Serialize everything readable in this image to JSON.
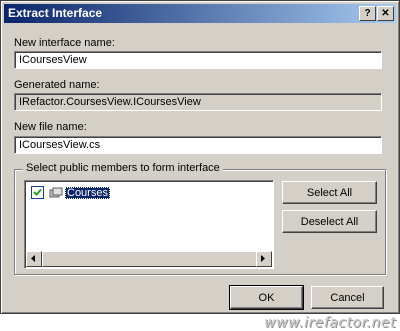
{
  "window": {
    "title": "Extract Interface",
    "help_button": "?",
    "close_button": "✕"
  },
  "fields": {
    "interface_name_label": "New interface name:",
    "interface_name_value": "ICoursesView",
    "generated_name_label": "Generated name:",
    "generated_name_value": "IRefactor.CoursesView.ICoursesView",
    "file_name_label": "New file name:",
    "file_name_value": "ICoursesView.cs"
  },
  "members": {
    "group_label": "Select public members to form interface",
    "items": [
      {
        "label": "Courses",
        "checked": true
      }
    ],
    "select_all_label": "Select All",
    "deselect_all_label": "Deselect All"
  },
  "buttons": {
    "ok_label": "OK",
    "cancel_label": "Cancel"
  },
  "watermark": "www.irefactor.net",
  "colors": {
    "titlebar_start": "#0a246a",
    "titlebar_end": "#a6caf0",
    "dialog_face": "#d4d0c8",
    "selection": "#0a246a"
  }
}
